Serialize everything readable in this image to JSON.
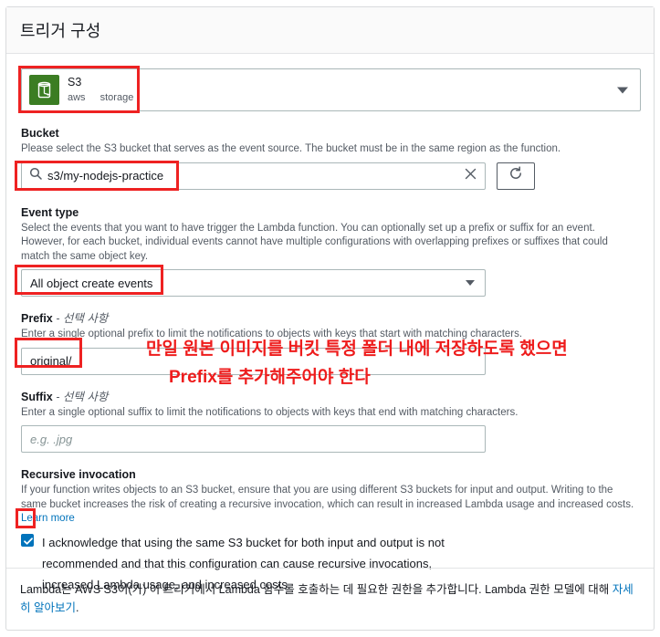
{
  "window": {
    "title": "트리거 구성"
  },
  "source": {
    "name": "S3",
    "tag_vendor": "aws",
    "tag_category": "storage",
    "icon": "s3-bucket-icon",
    "caret_icon": "chevron-down-icon"
  },
  "bucket": {
    "label": "Bucket",
    "description": "Please select the S3 bucket that serves as the event source. The bucket must be in the same region as the function.",
    "value": "s3/my-nodejs-practice",
    "search_icon": "search-icon",
    "clear_icon": "close-icon",
    "refresh_icon": "refresh-icon"
  },
  "event_type": {
    "label": "Event type",
    "description": "Select the events that you want to have trigger the Lambda function. You can optionally set up a prefix or suffix for an event. However, for each bucket, individual events cannot have multiple configurations with overlapping prefixes or suffixes that could match the same object key.",
    "value": "All object create events",
    "caret_icon": "chevron-down-icon"
  },
  "prefix": {
    "label": "Prefix",
    "optional_suffix": "- 선택 사항",
    "description": "Enter a single optional prefix to limit the notifications to objects with keys that start with matching characters.",
    "value": "original/"
  },
  "suffix": {
    "label": "Suffix",
    "optional_suffix": "- 선택 사항",
    "description": "Enter a single optional suffix to limit the notifications to objects with keys that end with matching characters.",
    "placeholder": "e.g. .jpg",
    "value": ""
  },
  "recursive": {
    "label": "Recursive invocation",
    "description": "If your function writes objects to an S3 bucket, ensure that you are using different S3 buckets for input and output. Writing to the same bucket increases the risk of creating a recursive invocation, which can result in increased Lambda usage and increased costs.",
    "learn_more": "Learn more",
    "checkbox_checked": true,
    "acknowledge_text": "I acknowledge that using the same S3 bucket for both input and output is not recommended and that this configuration can cause recursive invocations, increased Lambda usage, and increased costs."
  },
  "footer": {
    "text": "Lambda는 AWS S3이(가) 이 트리거에서 Lambda 함수를 호출하는 데 필요한 권한을 추가합니다. Lambda 권한 모델에 대해 ",
    "link": "자세히 알아보기",
    "period": "."
  },
  "annotations": {
    "line1": "만일 원본 이미지를 버킷 특정 폴더 내에 저장하도록 했으면",
    "line2": "Prefix를 추가해주어야 한다",
    "color": "#ee1c1c"
  },
  "colors": {
    "accent": "#0073bb",
    "s3_green": "#3b7d23",
    "annotation_red": "#ee2222",
    "border": "#aab7b8",
    "muted_text": "#545b64"
  }
}
